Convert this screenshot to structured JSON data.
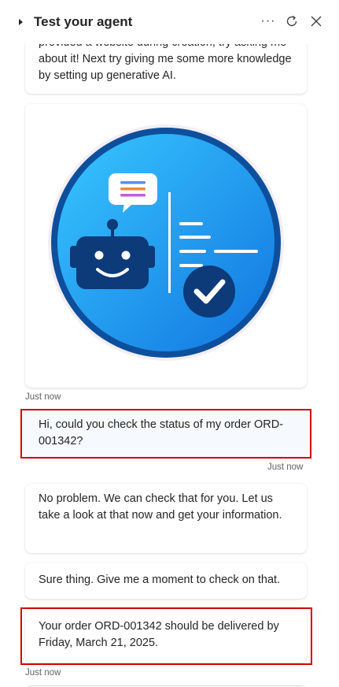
{
  "header": {
    "title": "Test your agent",
    "more_icon": "more-horizontal-icon",
    "refresh_icon": "refresh-icon",
    "close_icon": "close-icon"
  },
  "chat": {
    "intro_text": "provided a website during creation, try asking me about it! Next try giving me some more knowledge by setting up generative AI.",
    "image_card": {
      "icon": "agent-robot-illustration",
      "timestamp": "Just now"
    },
    "user_message": {
      "text": "Hi, could you check the status of my order ORD-001342?",
      "timestamp": "Just now"
    },
    "bot_messages": [
      {
        "text": "No problem. We can check that for you. Let us take a look at that now and get your information."
      },
      {
        "text": "Sure thing. Give me a moment to check on that."
      },
      {
        "text": "Your order ORD-001342 should be delivered by Friday, March 21, 2025."
      }
    ],
    "last_timestamp": "Just now"
  },
  "colors": {
    "highlight": "#d40000",
    "user_bubble": "#f6f9fe",
    "illustration_blue": "#1e90e8"
  }
}
